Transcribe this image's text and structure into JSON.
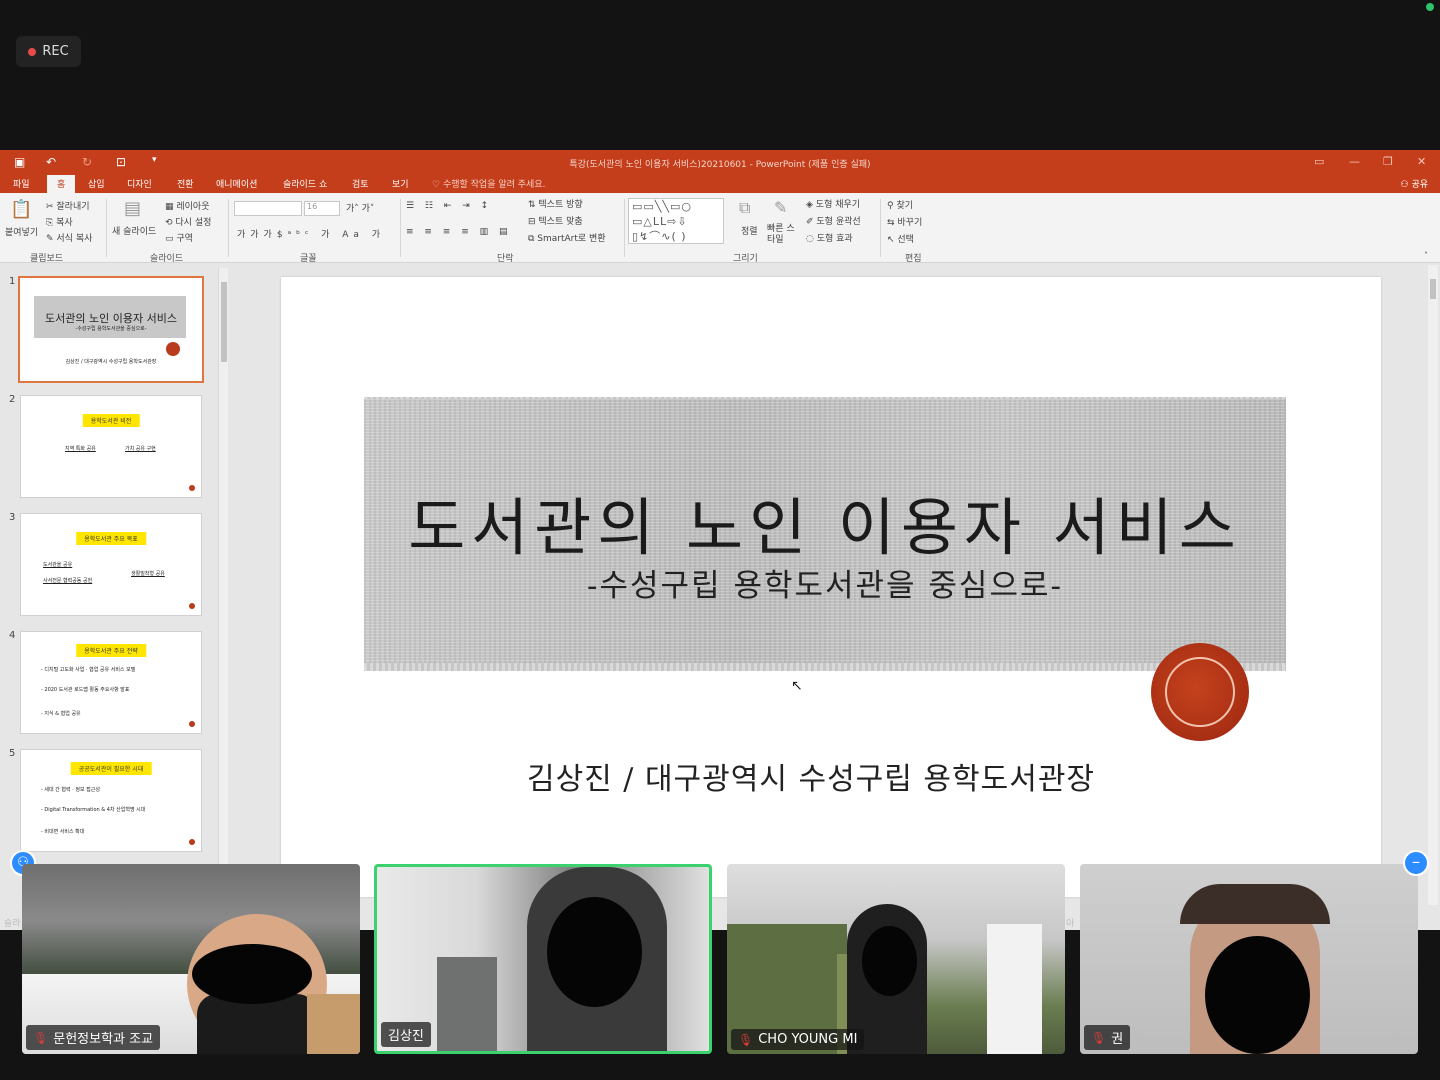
{
  "recording": {
    "label": "REC"
  },
  "window": {
    "title": "특강(도서관의 노인 이용자 서비스)20210601 - PowerPoint (제품 인증 실패)",
    "tell_me": "수행할 작업을 알려 주세요.",
    "share": "공유"
  },
  "menu": [
    "파일",
    "홈",
    "삽입",
    "디자인",
    "전환",
    "애니메이션",
    "슬라이드 쇼",
    "검토",
    "보기"
  ],
  "ribbon": {
    "clipboard": {
      "paste": "붙여넣기",
      "cut": "잘라내기",
      "copy": "복사",
      "format_painter": "서식 복사",
      "group": "클립보드"
    },
    "slides": {
      "new_slide": "새 슬라이드",
      "layout": "레이아웃",
      "reset": "다시 설정",
      "section": "구역",
      "group": "슬라이드"
    },
    "font": {
      "size": "16",
      "group": "글꼴"
    },
    "paragraph": {
      "text_direction": "텍스트 방향",
      "align_text": "텍스트 맞춤",
      "smartart": "SmartArt로 변환",
      "group": "단락"
    },
    "drawing": {
      "arrange": "정렬",
      "quick_styles": "빠른 스타일",
      "shape_fill": "도형 채우기",
      "shape_outline": "도형 윤곽선",
      "shape_effects": "도형 효과",
      "group": "그리기"
    },
    "editing": {
      "find": "찾기",
      "replace": "바꾸기",
      "select": "선택",
      "group": "편집"
    }
  },
  "thumbnails": [
    {
      "num": "1",
      "title": "도서관의 노인 이용자 서비스",
      "sub": "-수성구립 용학도서관을 중심으로-",
      "author": "김상진 / 대구광역시 수성구립 용학도서관장"
    },
    {
      "num": "2",
      "tag": "용학도서관 비전",
      "line1": "지역 특화 공유",
      "line2": "가치 공유 구현"
    },
    {
      "num": "3",
      "tag": "용학도서관 주요 목표",
      "line1": "도서관을 공유",
      "line2": "생활밀착형 공유",
      "line3": "사서전문 협력공동 공헌"
    },
    {
      "num": "4",
      "tag": "용학도서관 주요 전략",
      "line1": "- 디지털 고도화 사업 · 협업 공유 서비스 모델",
      "line2": "- 2020 도서관 로드맵 활동 주요사항 발표",
      "line3": "- 지식 & 협업 공유"
    },
    {
      "num": "5",
      "tag": "공공도서관이 필요한 시대",
      "line1": "- 세대 간 협력 · 정보 접근성",
      "line2": "- Digital Transformation & 4차 산업혁명 시대",
      "line3": "- 비대면 서비스 확대"
    }
  ],
  "slide": {
    "title": "도서관의 노인 이용자 서비스",
    "subtitle": "-수성구립 용학도서관을 중심으로-",
    "author": "김상진 / 대구광역시 수성구립 용학도서관장"
  },
  "status": {
    "left": "슬라",
    "right": "아"
  },
  "participants": [
    {
      "name": "문헌정보학과 조교",
      "muted": true,
      "speaking": false
    },
    {
      "name": "김상진",
      "muted": false,
      "speaking": true
    },
    {
      "name": "CHO YOUNG MI",
      "muted": true,
      "speaking": false
    },
    {
      "name": "권",
      "muted": true,
      "speaking": false
    }
  ],
  "icons": {
    "share": "person-icon",
    "mute": "mic-off-icon",
    "minimize": "minus-icon",
    "gallery": "gallery-view-icon"
  },
  "colors": {
    "accent": "#c43e1c",
    "speaking": "#3bd16f",
    "zoom_blue": "#2d8cff",
    "rec": "#e84a4a"
  }
}
